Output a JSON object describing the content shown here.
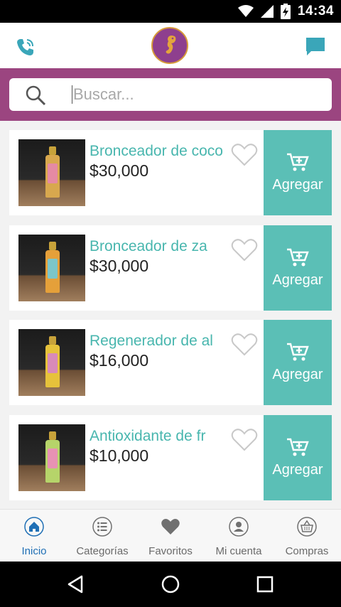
{
  "status_bar": {
    "time": "14:34"
  },
  "header": {
    "phone_icon": "phone-icon",
    "logo_icon": "seahorse-logo",
    "chat_icon": "chat-icon"
  },
  "search": {
    "placeholder": "Buscar...",
    "value": ""
  },
  "products": [
    {
      "name": "Bronceador de coco",
      "price": "$30,000",
      "add_label": "Agregar",
      "body_color": "#d8a84e",
      "label_color": "#e58aa3"
    },
    {
      "name": "Bronceador de za",
      "price": "$30,000",
      "add_label": "Agregar",
      "body_color": "#e5a03a",
      "label_color": "#7cc6c9"
    },
    {
      "name": "Regenerador de al",
      "price": "$16,000",
      "add_label": "Agregar",
      "body_color": "#e6c23b",
      "label_color": "#d88ab8"
    },
    {
      "name": "Antioxidante de fr",
      "price": "$10,000",
      "add_label": "Agregar",
      "body_color": "#b6d46a",
      "label_color": "#e792b3"
    }
  ],
  "bottom_nav": [
    {
      "label": "Inicio",
      "icon": "home-icon",
      "active": true
    },
    {
      "label": "Categorías",
      "icon": "list-icon",
      "active": false
    },
    {
      "label": "Favoritos",
      "icon": "heart-icon",
      "active": false
    },
    {
      "label": "Mi cuenta",
      "icon": "account-icon",
      "active": false
    },
    {
      "label": "Compras",
      "icon": "basket-icon",
      "active": false
    }
  ],
  "colors": {
    "accent": "#5bbfb6",
    "brand": "#9b4580",
    "nav_active": "#1f6fb5"
  }
}
